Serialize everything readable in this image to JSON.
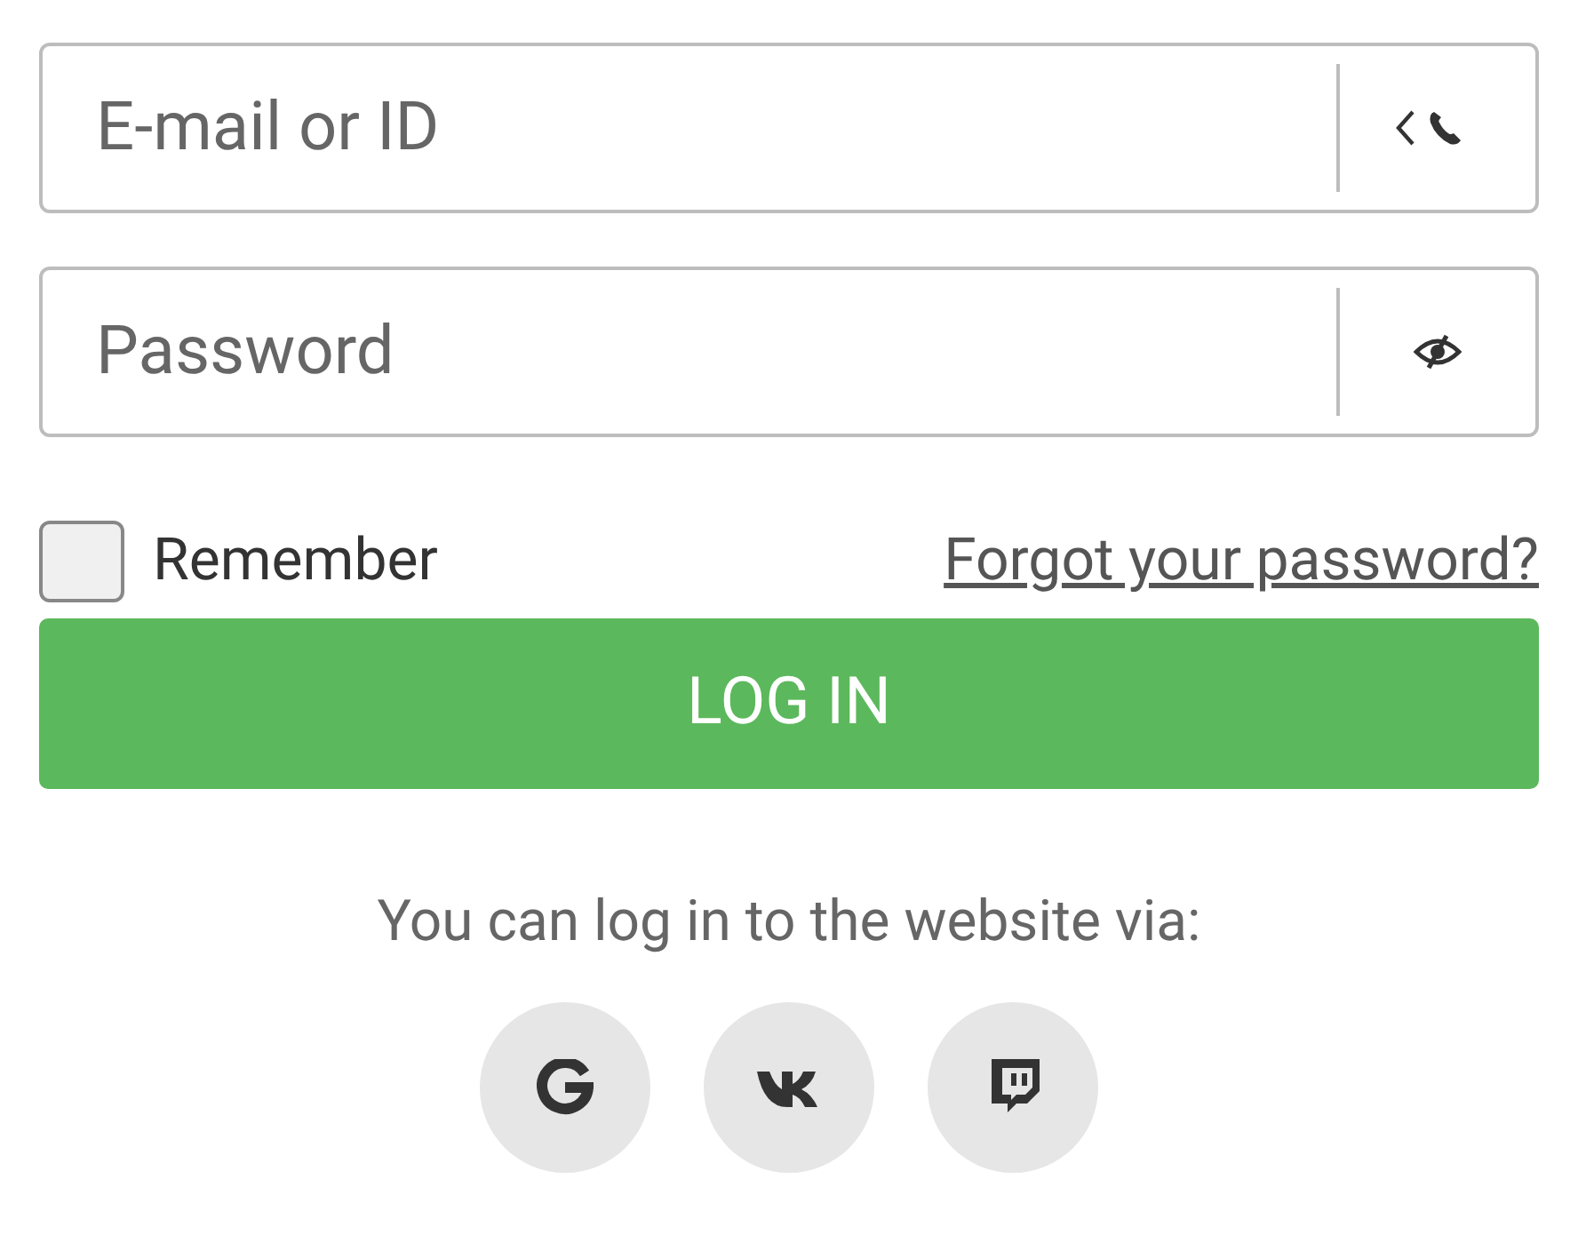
{
  "login_field": {
    "placeholder": "E-mail or ID"
  },
  "password_field": {
    "placeholder": "Password"
  },
  "remember": {
    "label": "Remember",
    "checked": false
  },
  "forgot_link": "Forgot your password?",
  "login_button": "LOG IN",
  "social_prompt": "You can log in to the website via:",
  "social_buttons": [
    {
      "kind": "google"
    },
    {
      "kind": "vk"
    },
    {
      "kind": "twitch"
    }
  ]
}
